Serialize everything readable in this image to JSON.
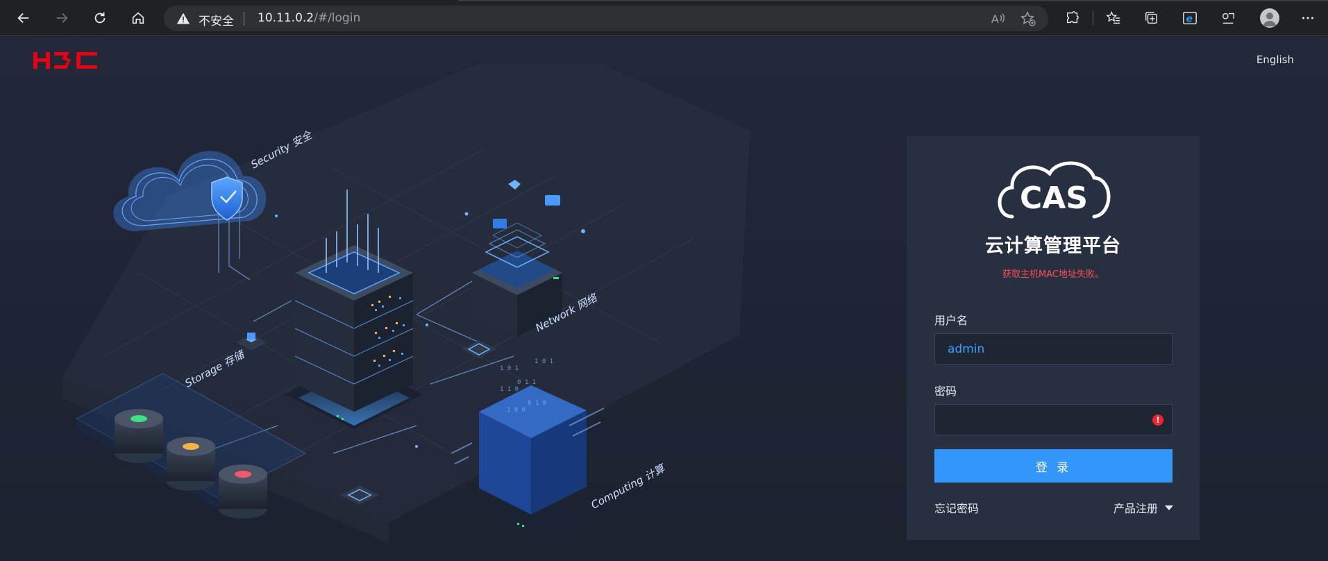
{
  "browser": {
    "insecure_label": "不安全",
    "url_host": "10.11.0.2",
    "url_path": "/#/login"
  },
  "header": {
    "brand": "H3C",
    "language_label": "English"
  },
  "illustration": {
    "security_label": "Security 安全",
    "network_label": "Network 网络",
    "storage_label": "Storage 存储",
    "computing_label": "Computing 计算"
  },
  "login": {
    "logo_text": "CAS",
    "platform_title": "云计算管理平台",
    "mac_error": "获取主机MAC地址失败。",
    "username_label": "用户名",
    "username_value": "admin",
    "password_label": "密码",
    "password_value": "",
    "password_error_icon": "!",
    "submit_label": "登 录",
    "forgot_password": "忘记密码",
    "product_register": "产品注册"
  },
  "colors": {
    "brand_red": "#e60012",
    "accent_blue": "#3296fa",
    "error_red": "#ff4d4f"
  }
}
